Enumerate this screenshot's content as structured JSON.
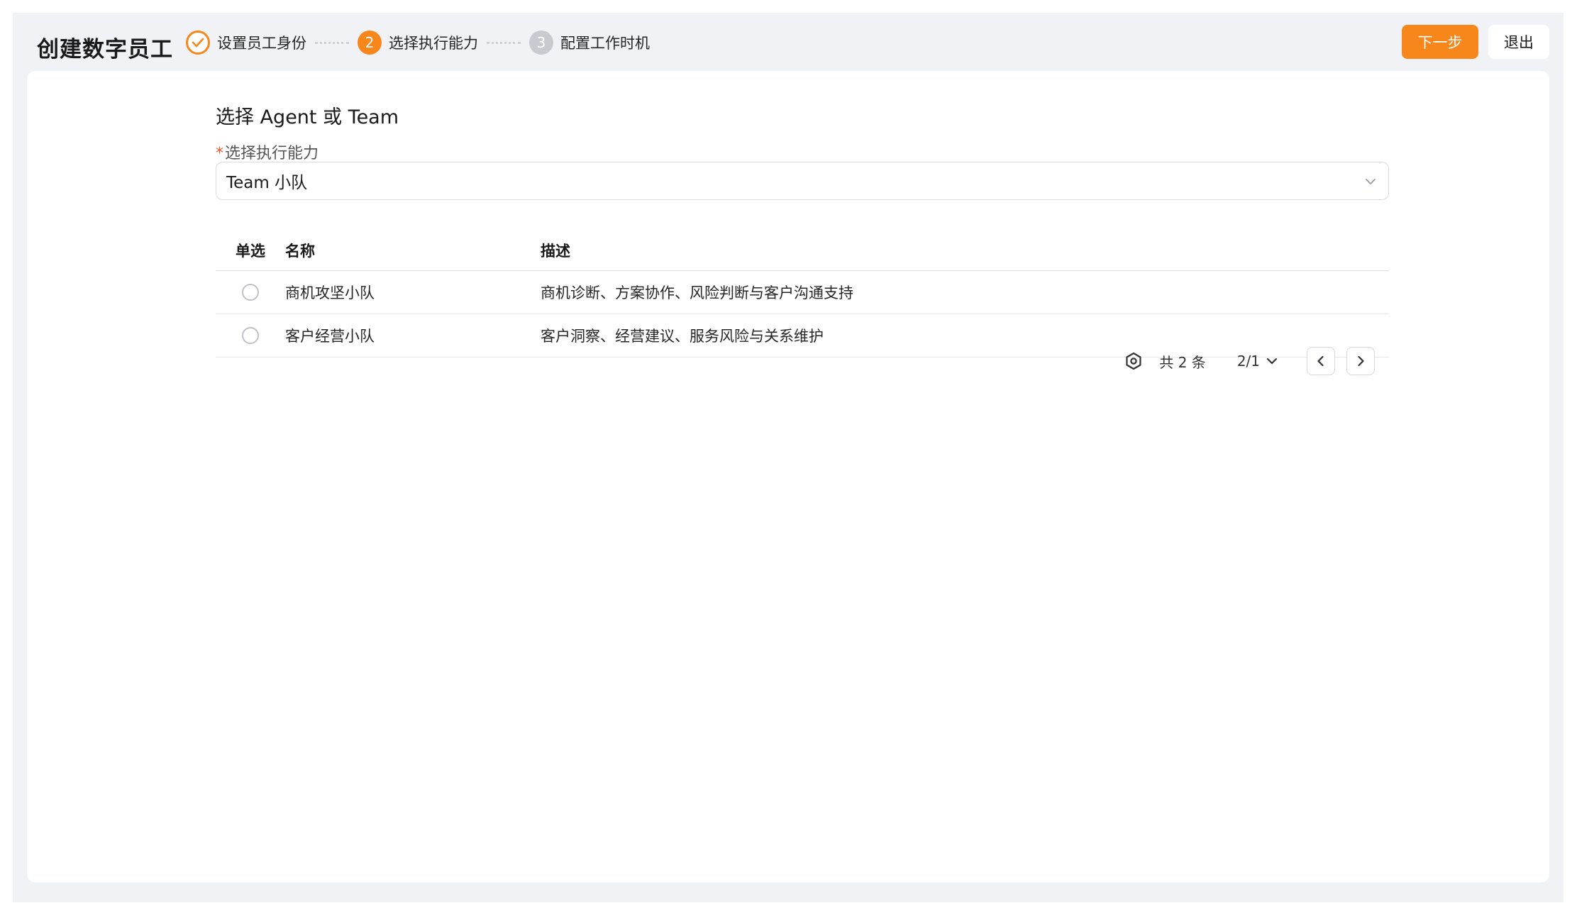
{
  "header": {
    "title": "创建数字员工",
    "steps": [
      {
        "number": "",
        "label": "设置员工身份",
        "status": "done"
      },
      {
        "number": "2",
        "label": "选择执行能力",
        "status": "active"
      },
      {
        "number": "3",
        "label": "配置工作时机",
        "status": "pending"
      }
    ],
    "next_label": "下一步",
    "exit_label": "退出"
  },
  "main": {
    "section_title": "选择 Agent 或 Team",
    "required_mark": "*",
    "field_label": "选择执行能力",
    "select_value": "Team 小队",
    "table": {
      "headers": [
        "单选",
        "名称",
        "描述"
      ],
      "rows": [
        {
          "name": "商机攻坚小队",
          "desc": "商机诊断、方案协作、风险判断与客户沟通支持"
        },
        {
          "name": "客户经营小队",
          "desc": "客户洞察、经营建议、服务风险与关系维护"
        }
      ]
    },
    "pagination": {
      "total": "共 2 条",
      "page": "2/1"
    }
  },
  "colors": {
    "accent": "#f7861b",
    "required": "#f5562b",
    "pending_step": "#c8cad0",
    "background": "#f1f2f6"
  }
}
